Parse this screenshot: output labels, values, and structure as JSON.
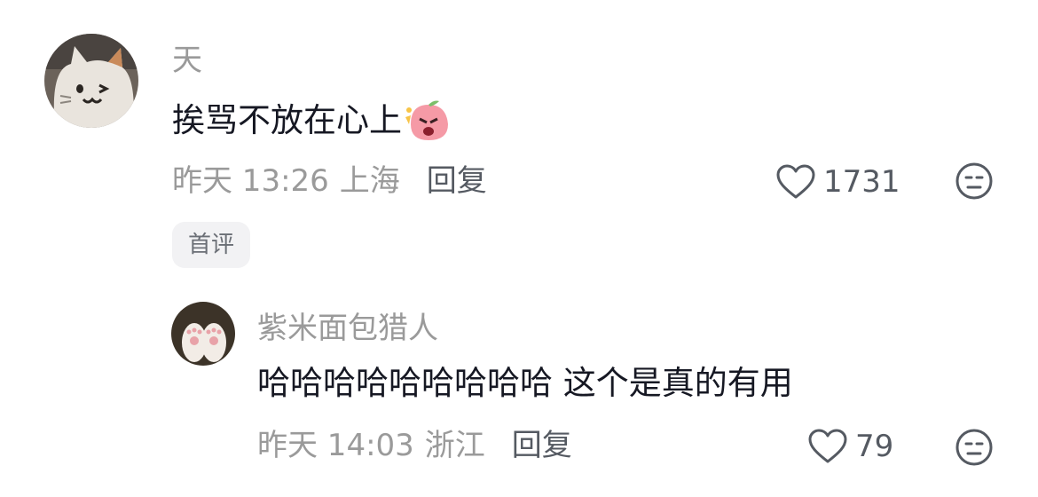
{
  "comments": [
    {
      "username": "天",
      "text": "挨骂不放在心上",
      "sticker": "angry-pink-peach-emoji",
      "time": "昨天 13:26",
      "location": "上海",
      "reply_label": "回复",
      "likes": "1731",
      "badge": "首评",
      "avatar": "cat-plush-avatar"
    },
    {
      "username": "紫米面包猎人",
      "text": "哈哈哈哈哈哈哈哈哈 这个是真的有用",
      "time": "昨天 14:03",
      "location": "浙江",
      "reply_label": "回复",
      "likes": "79",
      "avatar": "cat-paws-avatar"
    }
  ],
  "icons": {
    "like": "heart-outline-icon",
    "dislike": "neutral-face-icon"
  },
  "colors": {
    "username": "#9a9a9a",
    "text": "#161823",
    "meta": "#9a9a9a",
    "action": "#555a62",
    "badge_bg": "#f2f2f4"
  }
}
